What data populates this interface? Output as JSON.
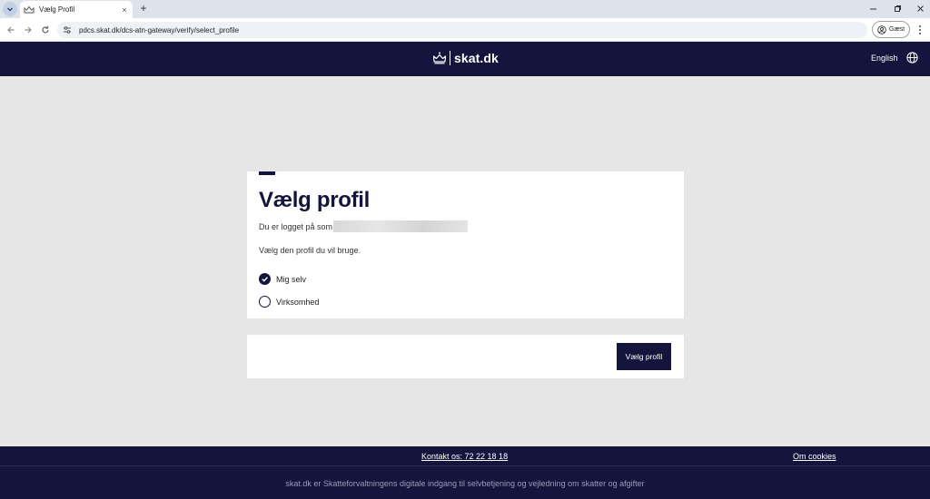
{
  "browser": {
    "tab_title": "Vælg Profil",
    "close_glyph": "×",
    "new_tab_glyph": "+",
    "url": "pdcs.skat.dk/dcs-atn-gateway/verify/select_profile",
    "profile_label": "Gæst",
    "icons": [
      "tab-search-icon",
      "favicon-crown-icon",
      "close-icon",
      "new-tab-icon",
      "minimize-icon",
      "restore-icon",
      "close-window-icon",
      "back-icon",
      "forward-icon",
      "reload-icon",
      "site-settings-icon",
      "profile-icon",
      "menu-icon"
    ]
  },
  "header": {
    "brand": "skat.dk",
    "language_link": "English",
    "icons": [
      "crown-logo-icon",
      "globe-icon"
    ],
    "background": "#14143c"
  },
  "profile_card": {
    "title": "Vælg profil",
    "logged_in_prefix": "Du er logget på som",
    "instruction": "Vælg den profil du vil bruge.",
    "options": [
      {
        "label": "Mig selv",
        "selected": true
      },
      {
        "label": "Virksomhed",
        "selected": false
      }
    ]
  },
  "actions": {
    "submit_label": "Vælg profil"
  },
  "footer": {
    "contact": "Kontakt os: 72 22 18 18",
    "cookies": "Om cookies",
    "tagline": "skat.dk er Skatteforvaltningens digitale indgang til selvbetjening og vejledning om skatter og afgifter"
  },
  "colors": {
    "brand_navy": "#14143c",
    "page_background": "#e6e6e6",
    "card_background": "#ffffff"
  }
}
